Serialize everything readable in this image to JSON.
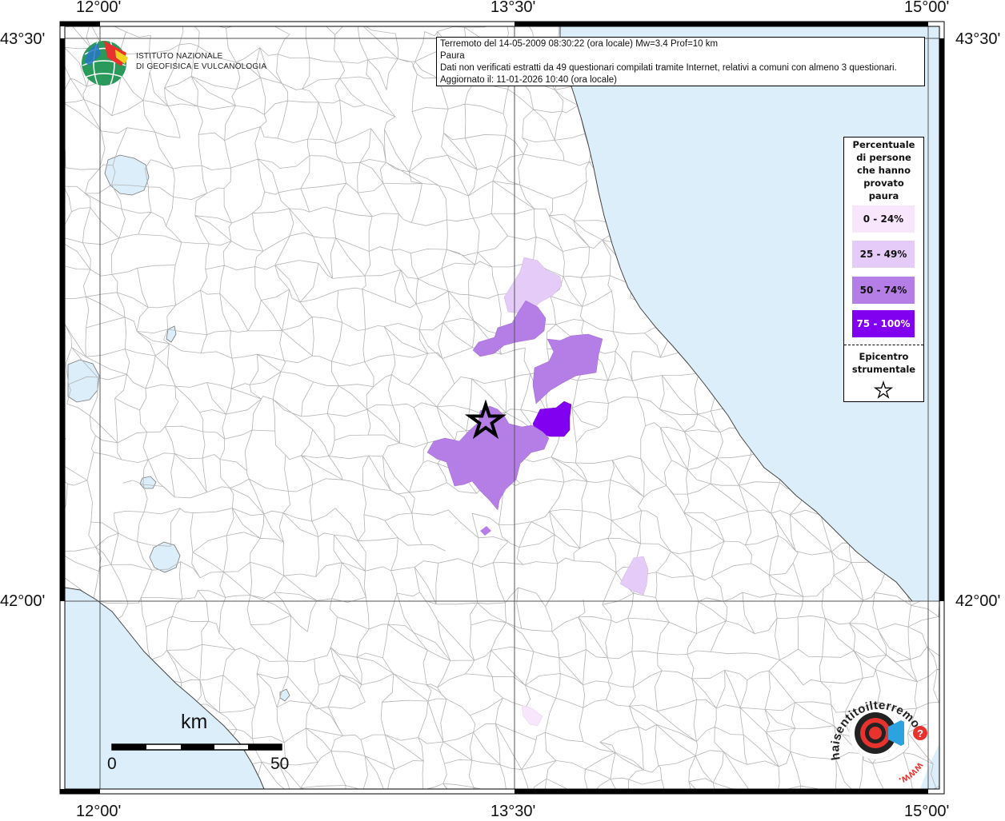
{
  "map": {
    "coords": {
      "top_left": "12°00'",
      "top_mid": "13°30'",
      "top_right": "15°00'",
      "bottom_left": "12°00'",
      "bottom_mid": "13°30'",
      "bottom_right": "15°00'",
      "left_top": "43°30'",
      "left_mid": "42°00'",
      "right_top": "43°30'",
      "right_mid": "42°00'"
    },
    "colors": {
      "sea": "#dceefa",
      "land": "#ffffff",
      "boundary": "#b4b4b4",
      "frame": "#000000"
    }
  },
  "info": {
    "line1": "Terremoto del 14-05-2009 08:30:22 (ora locale) Mw=3.4 Prof=10 km",
    "line2": "Paura",
    "line3": "Dati non verificati estratti da 49 questionari compilati tramite Internet, relativi a comuni con almeno 3 questionari.",
    "line4": "Aggiornato il: 11-01-2026 10:40 (ora locale)"
  },
  "legend": {
    "title_lines": [
      "Percentuale",
      "di persone",
      "che hanno",
      "provato",
      "paura"
    ],
    "classes": [
      {
        "label": "0 - 24%",
        "color": "#f8e6fc"
      },
      {
        "label": "25 - 49%",
        "color": "#e5cbf7"
      },
      {
        "label": "50 - 74%",
        "color": "#b47ee6"
      },
      {
        "label": "75 - 100%",
        "color": "#8200f0"
      }
    ],
    "epicenter_lines": [
      "Epicentro",
      "strumentale"
    ],
    "epicenter_icon": "star-outline-icon"
  },
  "logos": {
    "ingv_line1": "ISTITUTO NAZIONALE",
    "ingv_line2": "DI GEOFISICA E VULCANOLOGIA",
    "hsf_text": "haisentitoilterremoto.it",
    "hsf_url": "www."
  },
  "scale": {
    "unit": "km",
    "min_label": "0",
    "max_label": "50"
  }
}
